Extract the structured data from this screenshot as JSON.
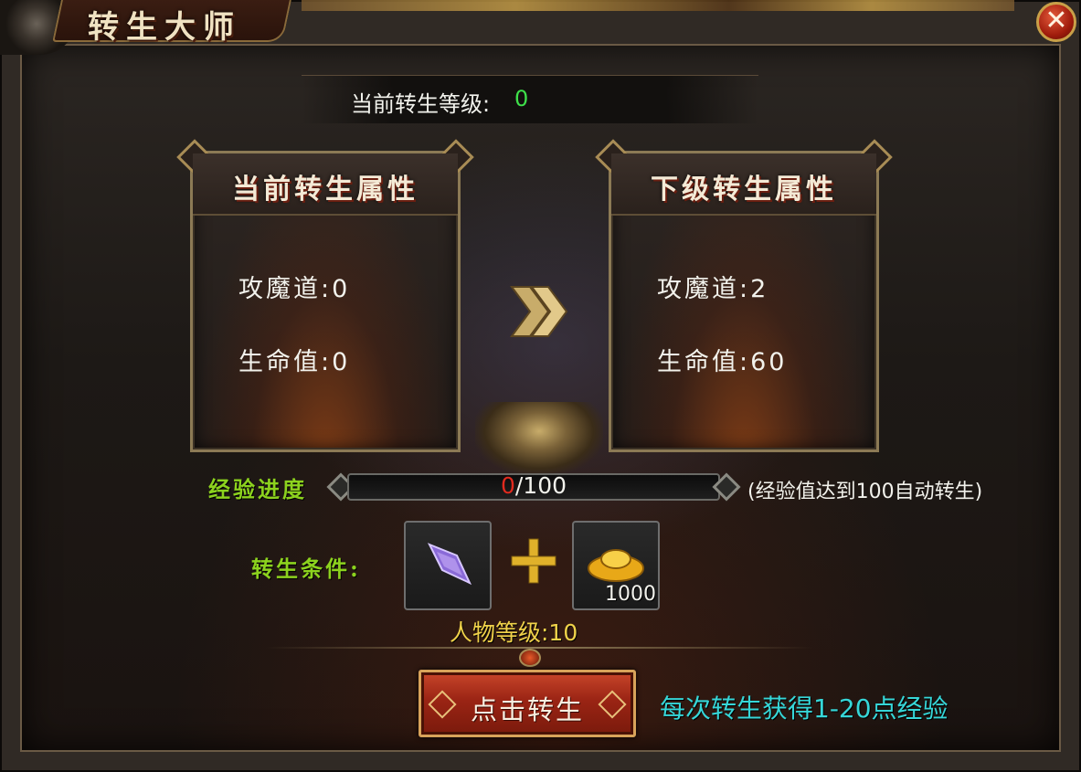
{
  "window": {
    "title": "转生大师",
    "close_label": "✕"
  },
  "current_level": {
    "label": "当前转生等级:",
    "value": "0"
  },
  "current_attrs": {
    "title": "当前转生属性",
    "stats": [
      {
        "label": "攻魔道:",
        "value": "0"
      },
      {
        "label": "生命值:",
        "value": "0"
      }
    ]
  },
  "next_attrs": {
    "title": "下级转生属性",
    "stats": [
      {
        "label": "攻魔道:",
        "value": "2"
      },
      {
        "label": "生命值:",
        "value": "60"
      }
    ]
  },
  "experience": {
    "label": "经验进度",
    "current": "0",
    "max": "/100",
    "progress_fraction": 0.0,
    "note": "(经验值达到100自动转生)"
  },
  "conditions": {
    "label": "转生条件:",
    "items": [
      {
        "icon": "purple-crystal-icon",
        "count": ""
      },
      {
        "icon": "gold-ingot-icon",
        "count": "1000"
      }
    ],
    "required_level": "人物等级:10"
  },
  "action": {
    "button_label": "点击转生",
    "tip": "每次转生获得1-20点经验"
  },
  "colors": {
    "accent_green": "#3ee04a",
    "label_green": "#8cd21e",
    "gold": "#f0d24a",
    "cyan": "#36d6d8",
    "button_red": "#9a2414"
  }
}
